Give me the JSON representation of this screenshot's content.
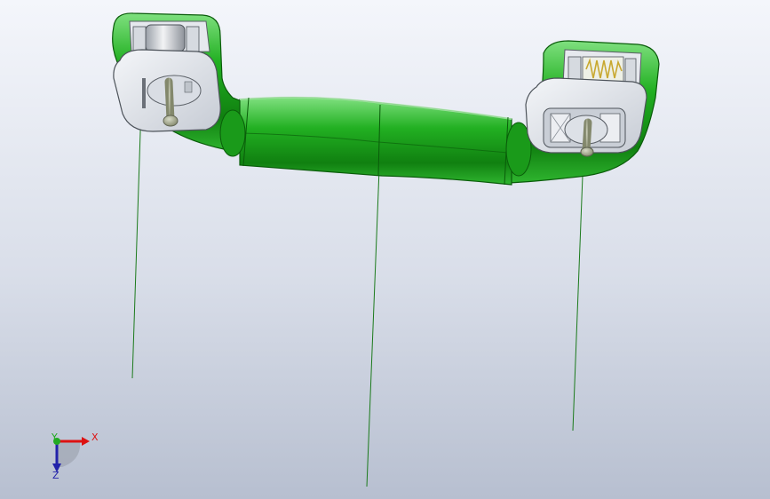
{
  "viewport": {
    "background_top": "#f4f6fb",
    "background_bottom": "#b7bfd0"
  },
  "model": {
    "body_color": "#21a821",
    "body_dark": "#0c6e0c",
    "body_light": "#8fe48f",
    "clip_color": "#dfe3ea",
    "pin_color": "#9fa48c",
    "spring_color": "#c8b040",
    "guide_line_color": "#1b7a1b"
  },
  "triad": {
    "x_label": "X",
    "y_label": "Y",
    "z_label": "Z",
    "x_color": "#dd1111",
    "y_color": "#22aa22",
    "z_color": "#2222aa"
  }
}
